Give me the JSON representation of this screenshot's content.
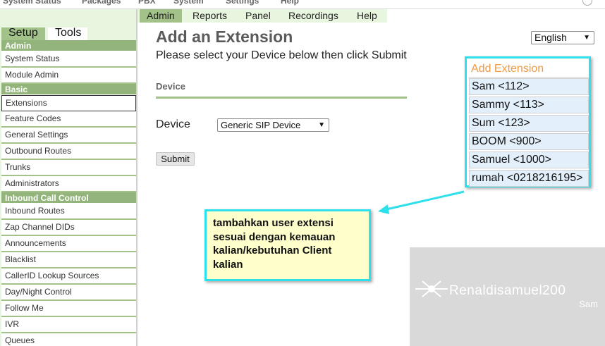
{
  "topbar": {
    "items": [
      "System Status",
      "Packages",
      "PBX",
      "System",
      "Settings",
      "Help"
    ]
  },
  "sidebar": {
    "tabs": [
      "Setup",
      "Tools"
    ],
    "groups": [
      {
        "header": "Admin",
        "items": [
          "System Status",
          "Module Admin"
        ]
      },
      {
        "header": "Basic",
        "items": [
          "Extensions",
          "Feature Codes",
          "General Settings",
          "Outbound Routes",
          "Trunks",
          "Administrators"
        ]
      },
      {
        "header": "Inbound Call Control",
        "items": [
          "Inbound Routes",
          "Zap Channel DIDs",
          "Announcements",
          "Blacklist",
          "CallerID Lookup Sources",
          "Day/Night Control",
          "Follow Me",
          "IVR",
          "Queues"
        ]
      }
    ],
    "active_item": "Extensions"
  },
  "module_menu": {
    "items": [
      "Admin",
      "Reports",
      "Panel",
      "Recordings",
      "Help"
    ],
    "active": "Admin"
  },
  "main": {
    "title": "Add an Extension",
    "subtitle": "Please select your Device below then click Submit",
    "section_label": "Device",
    "device_label": "Device",
    "device_select_value": "Generic SIP Device",
    "submit_label": "Submit",
    "language_select_value": "English"
  },
  "extension_panel": {
    "title": "Add Extension",
    "items": [
      "Sam <112>",
      "Sammy <113>",
      "Sum <123>",
      "BOOM <900>",
      "Samuel <1000>",
      "rumah <0218216195>"
    ]
  },
  "callout": {
    "text": "tambahkan user extensi sesuai dengan kemauan kalian/kebutuhan Client kalian"
  },
  "watermark": {
    "name": "Renaldisamuel200",
    "sub": "Sam"
  },
  "colors": {
    "accent_green": "#a3c28a",
    "header_green": "#93b57b",
    "highlight_cyan": "#2ee0ec",
    "extension_title": "#f09a45",
    "callout_bg": "#ffffcc"
  }
}
